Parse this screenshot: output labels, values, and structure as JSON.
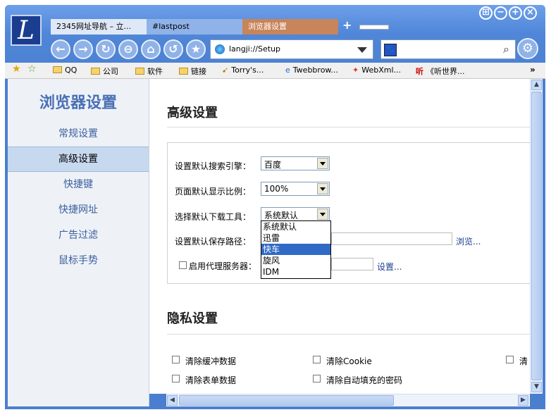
{
  "tabs": [
    {
      "label": "2345网址导航 – 立..."
    },
    {
      "label": "#lastpost"
    },
    {
      "label": "浏览器设置"
    }
  ],
  "new_tab_symbol": "+",
  "address": {
    "url": "langji://Setup"
  },
  "bookmarks": [
    {
      "label": "QQ"
    },
    {
      "label": "公司"
    },
    {
      "label": "软件"
    },
    {
      "label": "链接"
    },
    {
      "label": "Torry's..."
    },
    {
      "label": "Twebbrow..."
    },
    {
      "label": "WebXml..."
    },
    {
      "label": "《听世界..."
    }
  ],
  "bookmark_more": "»",
  "sidebar": {
    "title": "浏览器设置",
    "items": [
      {
        "label": "常规设置"
      },
      {
        "label": "高级设置"
      },
      {
        "label": "快捷键"
      },
      {
        "label": "快捷网址"
      },
      {
        "label": "广告过滤"
      },
      {
        "label": "鼠标手势"
      }
    ]
  },
  "advanced": {
    "heading": "高级设置",
    "search_engine_label": "设置默认搜索引擎：",
    "search_engine_value": "百度",
    "zoom_label": "页面默认显示比例：",
    "zoom_value": "100%",
    "download_label": "选择默认下载工具：",
    "download_value": "系统默认",
    "download_options": [
      "系统默认",
      "迅雷",
      "快车",
      "旋风",
      "IDM"
    ],
    "save_path_label": "设置默认保存路径：",
    "browse_link": "浏览...",
    "proxy_label": "启用代理服务器：",
    "proxy_settings_link": "设置..."
  },
  "privacy": {
    "heading": "隐私设置",
    "clear_cache": "清除缓冲数据",
    "clear_cookie": "清除Cookie",
    "clear_form": "清除表单数据",
    "clear_passwords": "清除自动填充的密码",
    "clear_third": "清"
  },
  "colors": {
    "accent": "#4a7fd0",
    "sidebar_active": "#c7d9ee",
    "selection": "#316ac5"
  }
}
